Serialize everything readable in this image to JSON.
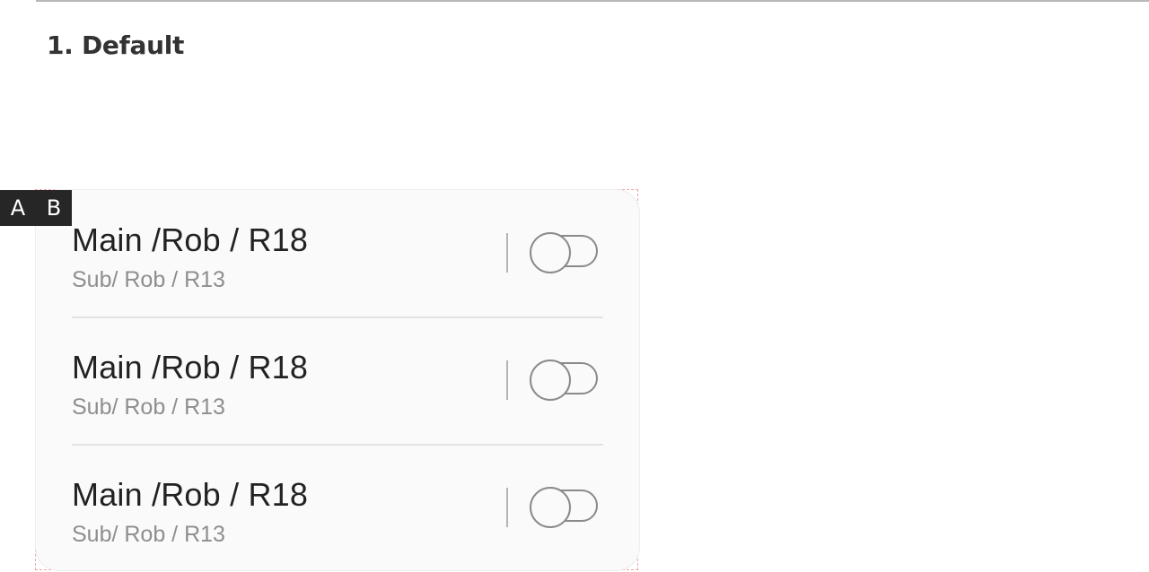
{
  "section": {
    "title": "1. Default"
  },
  "badge": {
    "a": "A",
    "b": "B"
  },
  "list": {
    "items": [
      {
        "main": "Main /Rob / R18",
        "sub": "Sub/ Rob / R13",
        "switch_on": false
      },
      {
        "main": "Main /Rob / R18",
        "sub": "Sub/ Rob / R13",
        "switch_on": false
      },
      {
        "main": "Main /Rob / R18",
        "sub": "Sub/ Rob / R13",
        "switch_on": false
      }
    ]
  },
  "colors": {
    "main_text": "#222222",
    "sub_text": "#8e8e8e",
    "switch_outline": "#8a8a8a",
    "card_background": "#fafafa",
    "badge_background": "#262626"
  }
}
